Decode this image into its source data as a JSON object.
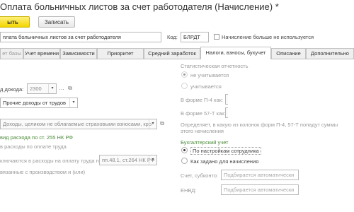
{
  "header": {
    "title": "Оплата больничных листов за счет работодателя (Начисление) *",
    "post_close_label": "ыть",
    "save_label": "Записать",
    "more_label": "…",
    "help_label": "?"
  },
  "name_row": {
    "name_value": "плата больничных листов за счет работодателя",
    "code_label": "Код:",
    "code_value": "БЛРДТ",
    "unused_label": "Начисление больше не используется"
  },
  "tabs": [
    "ет базы",
    "Учет времени",
    "Зависимости",
    "Приоритет",
    "Средний заработок",
    "Налоги, взносы, бухучет",
    "Описание",
    "Дополнительно"
  ],
  "left": {
    "income_code_label": "д дохода:",
    "income_code_value": "2300",
    "income_kind_value": "Прочие доходы от трудов",
    "insurance_value": "Доходы, целиком не облагаемые страховыми взносами, кро",
    "expense_title": "вид расхода по ст. 255 НК РФ",
    "expense_sub": "в расходы по оплате труда",
    "article_label": "ключаются в расходы на оплату труда по статье:",
    "article_value": "пп.48.1, ст.264 НК РФ",
    "related_label": "вязанные с производством и (или)"
  },
  "right": {
    "stat_title": "Статистическая отчетность",
    "not_counted": "не учитывается",
    "counted": "учитывается",
    "p4_label": "В форме П-4 как:",
    "t57_label": "В форме 57-Т как:",
    "hint_text": "Определяет, в какую из колонок форм П-4, 57-Т попадут суммы этого начисления",
    "acc_title": "Бухгалтерский учет",
    "by_employee": "По настройкам сотрудника",
    "as_set": "Как задано для начисления",
    "account_label": "Счет, субконто:",
    "account_ph": "Подбирается автоматически",
    "envd_label": "ЕНВД:",
    "envd_ph": "Подбирается автоматически"
  },
  "colors": {
    "accent_yellow": "#f5d800",
    "green_heading": "#4b8a3a"
  }
}
